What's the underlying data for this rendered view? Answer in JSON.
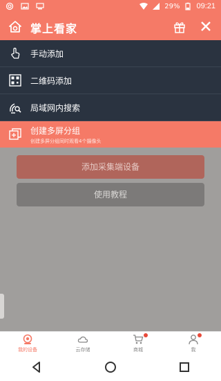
{
  "status_bar": {
    "battery": "29%",
    "time": "09:21"
  },
  "header": {
    "title": "掌上看家",
    "icons": {
      "logo": "home-eye-icon",
      "gift": "gift-icon",
      "close": "close-icon"
    }
  },
  "menu": {
    "items": [
      {
        "label": "手动添加",
        "icon": "hand-tap-icon"
      },
      {
        "label": "二维码添加",
        "icon": "qr-code-icon"
      },
      {
        "label": "局域网内搜索",
        "icon": "lan-search-icon"
      }
    ],
    "highlight": {
      "label": "创建多屏分组",
      "sublabel": "创建多屏分组同时观看4个摄像头",
      "icon": "multi-screen-icon"
    }
  },
  "main": {
    "add_button": "添加采集端设备",
    "tutorial_button": "使用教程"
  },
  "tabs": [
    {
      "label": "我的设备",
      "icon": "camera-icon",
      "active": true,
      "badge": false
    },
    {
      "label": "云存储",
      "icon": "cloud-icon",
      "active": false,
      "badge": false
    },
    {
      "label": "商城",
      "icon": "cart-icon",
      "active": false,
      "badge": true
    },
    {
      "label": "我",
      "icon": "person-icon",
      "active": false,
      "badge": true
    }
  ],
  "colors": {
    "accent": "#f57a67",
    "menu_bg": "#2a3340",
    "overlay_bg": "#a09e9c"
  }
}
